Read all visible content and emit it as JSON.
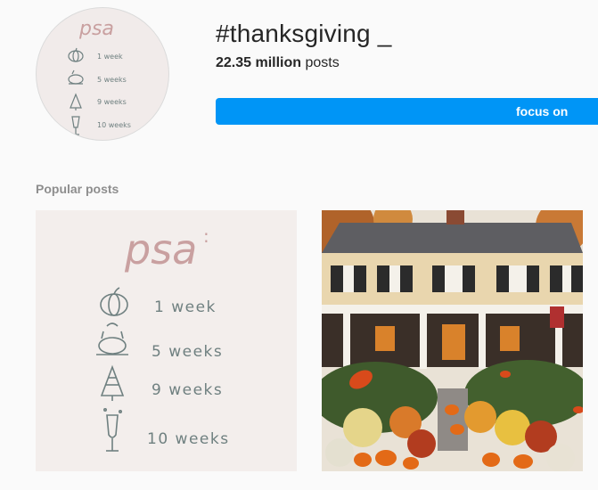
{
  "header": {
    "hashtag": "#thanksgiving _",
    "post_count": "22.35 million",
    "post_count_suffix": "posts",
    "follow_label": "focus on"
  },
  "section": {
    "popular_label": "Popular posts"
  },
  "card": {
    "title": "psa",
    "colon": ":",
    "rows": [
      {
        "icon": "pumpkin-icon",
        "label": "1 week"
      },
      {
        "icon": "turkey-icon",
        "label": "5 weeks"
      },
      {
        "icon": "christmas-tree-icon",
        "label": "9 weeks"
      },
      {
        "icon": "champagne-glass-icon",
        "label": "10 weeks"
      }
    ]
  },
  "colors": {
    "accent": "#0095f6",
    "card_bg": "#f3eeec",
    "psa_pink": "#c9a0a0",
    "icon_gray": "#6f8080"
  }
}
